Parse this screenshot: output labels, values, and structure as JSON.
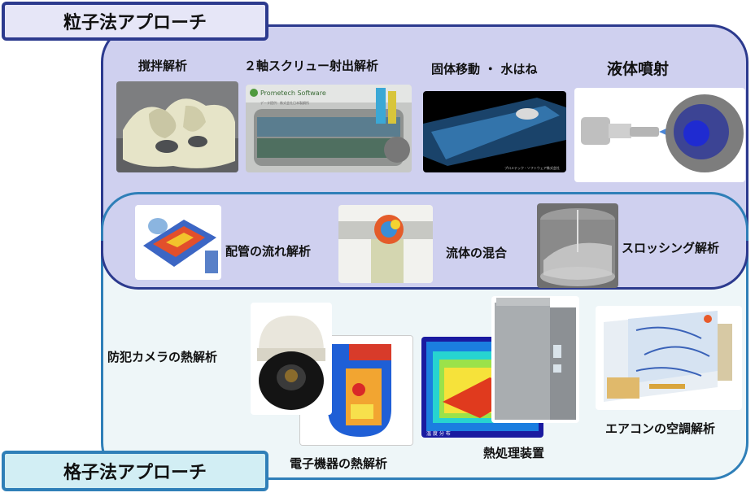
{
  "approaches": {
    "particle": "粒子法アプローチ",
    "grid": "格子法アプローチ"
  },
  "particle_items": [
    {
      "label": "撹拌解析"
    },
    {
      "label": "２軸スクリュー射出解析",
      "image_text": [
        "Prometech Software",
        "データ提供：株式会社日本製鋼所"
      ]
    },
    {
      "label": "固体移動 ・ 水はね",
      "image_text": "プロメテック・ソフトウェア株式会社"
    },
    {
      "label": "液体噴射"
    }
  ],
  "overlap_items": [
    {
      "label": "配管の流れ解析"
    },
    {
      "label": "流体の混合"
    },
    {
      "label": "スロッシング解析"
    }
  ],
  "grid_items": [
    {
      "label": "防犯カメラの熱解析"
    },
    {
      "label": "電子機器の熱解析"
    },
    {
      "label": "熱処理装置",
      "image_text": "温 度 分 布"
    },
    {
      "label": "エアコンの空調解析"
    }
  ]
}
